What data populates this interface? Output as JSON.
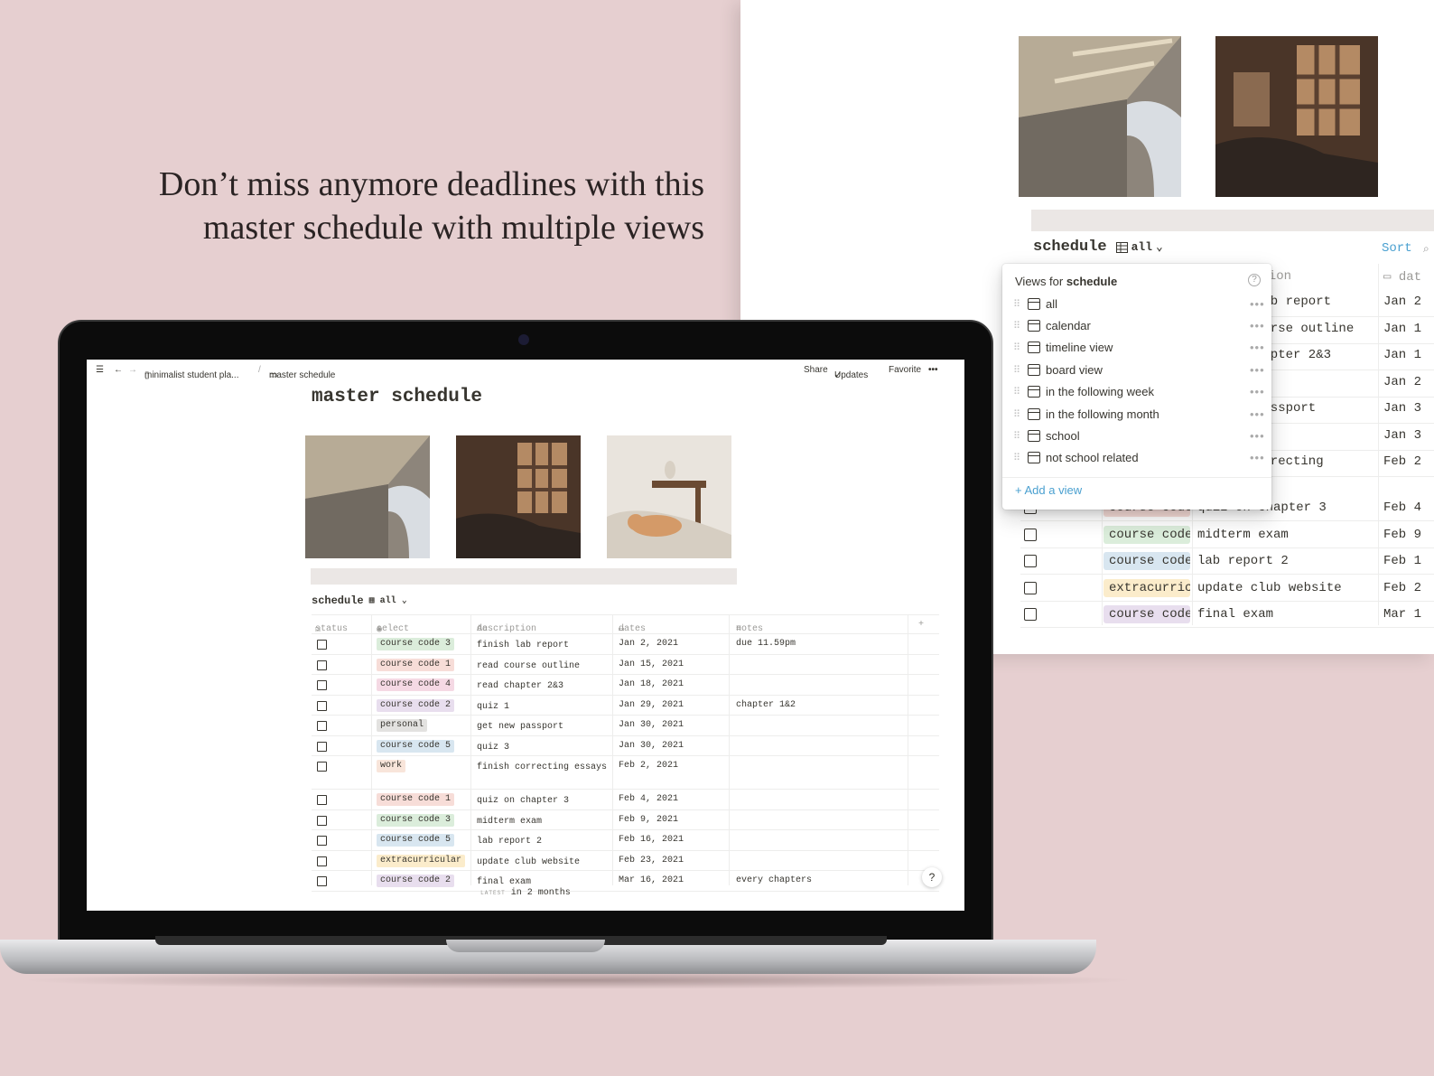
{
  "headline": {
    "line1": "Don’t miss anymore deadlines with this",
    "line2": "master schedule with multiple views"
  },
  "breadcrumb": {
    "workspace": "minimalist student pla...",
    "page": "master schedule"
  },
  "topbar": {
    "share": "Share",
    "updates": "Updates",
    "favorite": "Favorite",
    "more": "•••"
  },
  "page_title": "master schedule",
  "database": {
    "title": "schedule",
    "view": "all",
    "sort": "Sort"
  },
  "columns": {
    "status": "status",
    "select": "select",
    "description": "description",
    "dates": "dates",
    "notes": "notes"
  },
  "rows": [
    {
      "tag": "course code 3",
      "tag_color": "#dbeddb",
      "desc": "finish lab report",
      "date": "Jan 2, 2021",
      "note": "due 11.59pm"
    },
    {
      "tag": "course code 1",
      "tag_color": "#f7ddd8",
      "desc": "read course outline",
      "date": "Jan 15, 2021",
      "note": ""
    },
    {
      "tag": "course code 4",
      "tag_color": "#f5d9e4",
      "desc": "read chapter 2&3",
      "date": "Jan 18, 2021",
      "note": ""
    },
    {
      "tag": "course code 2",
      "tag_color": "#e8deee",
      "desc": "quiz 1",
      "date": "Jan 29, 2021",
      "note": "chapter 1&2"
    },
    {
      "tag": "personal",
      "tag_color": "#e3e2e0",
      "desc": "get new passport",
      "date": "Jan 30, 2021",
      "note": ""
    },
    {
      "tag": "course code 5",
      "tag_color": "#d8e6f0",
      "desc": "quiz 3",
      "date": "Jan 30, 2021",
      "note": ""
    },
    {
      "tag": "work",
      "tag_color": "#f8e5da",
      "desc": "finish correcting essays",
      "date": "Feb 2, 2021",
      "note": ""
    },
    {
      "tag": "course code 1",
      "tag_color": "#f7ddd8",
      "desc": "quiz on chapter 3",
      "date": "Feb 4, 2021",
      "note": ""
    },
    {
      "tag": "course code 3",
      "tag_color": "#dbeddb",
      "desc": "midterm exam",
      "date": "Feb 9, 2021",
      "note": ""
    },
    {
      "tag": "course code 5",
      "tag_color": "#d8e6f0",
      "desc": "lab report 2",
      "date": "Feb 16, 2021",
      "note": ""
    },
    {
      "tag": "extracurricular",
      "tag_color": "#fbeccb",
      "desc": "update club website",
      "date": "Feb 23, 2021",
      "note": ""
    },
    {
      "tag": "course code 2",
      "tag_color": "#e8deee",
      "desc": "final exam",
      "date": "Mar 16, 2021",
      "note": "every chapters"
    }
  ],
  "footer": {
    "latest": "LATEST",
    "relative": "in 2 months"
  },
  "help": "?",
  "views_popup": {
    "title_prefix": "Views for",
    "title_db": "schedule",
    "views": [
      "all",
      "calendar",
      "timeline view",
      "board view",
      "in the following week",
      "in the following month",
      "school",
      "not school related"
    ],
    "add": "Add a view"
  },
  "zoom": {
    "col_description_partial": "ption",
    "col_dates_partial": "dat",
    "cells": [
      {
        "desc": "lab report",
        "date": "Jan 2"
      },
      {
        "desc": "ourse outline",
        "date": "Jan 1"
      },
      {
        "desc": "hapter 2&3",
        "date": "Jan 1"
      },
      {
        "desc": "",
        "date": "Jan 2"
      },
      {
        "desc": "passport",
        "date": "Jan 3"
      },
      {
        "desc": "",
        "date": "Jan 3"
      },
      {
        "desc": "orrecting",
        "date": "Feb 2"
      }
    ],
    "full_rows": [
      {
        "tag": "course code",
        "tag_color": "#f7ddd8",
        "desc": "quiz on chapter 3",
        "date": "Feb 4"
      },
      {
        "tag": "course code",
        "tag_color": "#dbeddb",
        "desc": "midterm exam",
        "date": "Feb 9"
      },
      {
        "tag": "course code",
        "tag_color": "#d8e6f0",
        "desc": "lab report 2",
        "date": "Feb 1"
      },
      {
        "tag": "extracurricular",
        "tag_color": "#fbeccb",
        "desc": "update club website",
        "date": "Feb 2"
      },
      {
        "tag": "course code",
        "tag_color": "#e8deee",
        "desc": "final exam",
        "date": "Mar 1"
      }
    ]
  }
}
